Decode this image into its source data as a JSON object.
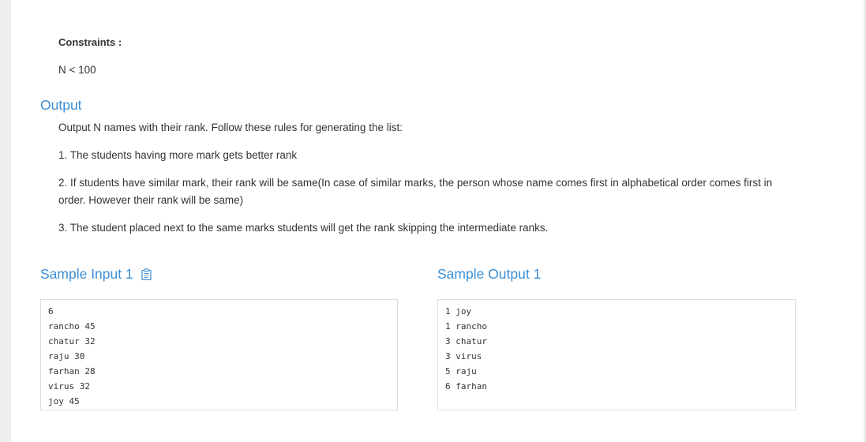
{
  "constraints": {
    "label": "Constraints :",
    "value": "N < 100"
  },
  "output": {
    "heading": "Output",
    "intro": "Output N names with their rank. Follow these rules for generating the list:",
    "rule1": "1. The students having more mark gets better rank",
    "rule2_line1": "2. If students have similar mark, their rank will be same(In case of similar marks, the person whose name comes first in alphabetical order comes first in",
    "rule2_line2": "order. However their rank will be same)",
    "rule3": "3. The student placed next to the same marks students will get the rank skipping the intermediate ranks."
  },
  "sample_input": {
    "heading": "Sample Input 1",
    "copy_icon": "clipboard-icon",
    "lines": [
      "6",
      "rancho 45",
      "chatur 32",
      "raju 30",
      "farhan 28",
      "virus 32",
      "joy 45"
    ]
  },
  "sample_output": {
    "heading": "Sample Output 1",
    "lines": [
      "1 joy",
      "1 rancho",
      "3 chatur",
      "3 virus",
      "5 raju",
      "6 farhan"
    ]
  },
  "colors": {
    "heading": "#3b8ed4",
    "text": "#333333",
    "background": "#eeeeee",
    "panel": "#ffffff",
    "code_border": "#dddddd"
  }
}
